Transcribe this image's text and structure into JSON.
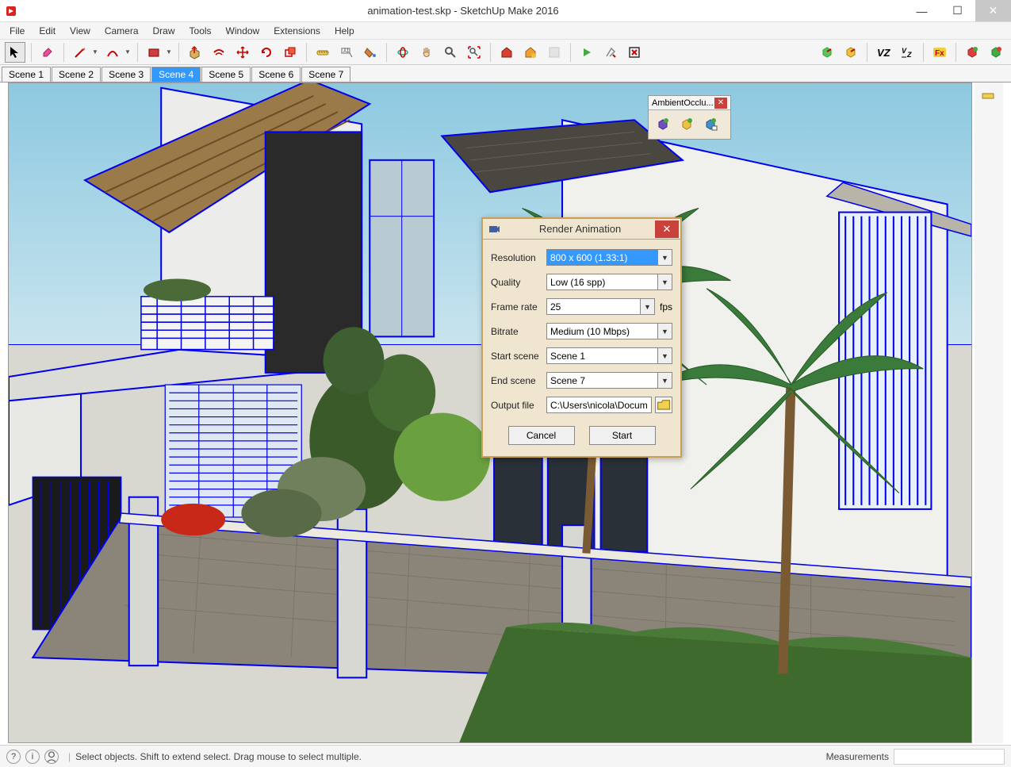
{
  "window": {
    "title": "animation-test.skp - SketchUp Make 2016"
  },
  "menu": {
    "items": [
      "File",
      "Edit",
      "View",
      "Camera",
      "Draw",
      "Tools",
      "Window",
      "Extensions",
      "Help"
    ]
  },
  "scenes": {
    "tabs": [
      "Scene 1",
      "Scene 2",
      "Scene 3",
      "Scene 4",
      "Scene 5",
      "Scene 6",
      "Scene 7"
    ],
    "active_index": 3
  },
  "float_panel": {
    "title": "AmbientOcclu..."
  },
  "dialog": {
    "title": "Render Animation",
    "labels": {
      "resolution": "Resolution",
      "quality": "Quality",
      "frame_rate": "Frame rate",
      "bitrate": "Bitrate",
      "start_scene": "Start scene",
      "end_scene": "End scene",
      "output_file": "Output file"
    },
    "values": {
      "resolution": "800 x 600 (1.33:1)",
      "quality": "Low (16 spp)",
      "frame_rate": "25",
      "frame_rate_suffix": "fps",
      "bitrate": "Medium (10 Mbps)",
      "start_scene": "Scene 1",
      "end_scene": "Scene 7",
      "output_file": "C:\\Users\\nicola\\Docum"
    },
    "buttons": {
      "cancel": "Cancel",
      "start": "Start"
    }
  },
  "statusbar": {
    "hint": "Select objects. Shift to extend select. Drag mouse to select multiple.",
    "measurements_label": "Measurements"
  }
}
